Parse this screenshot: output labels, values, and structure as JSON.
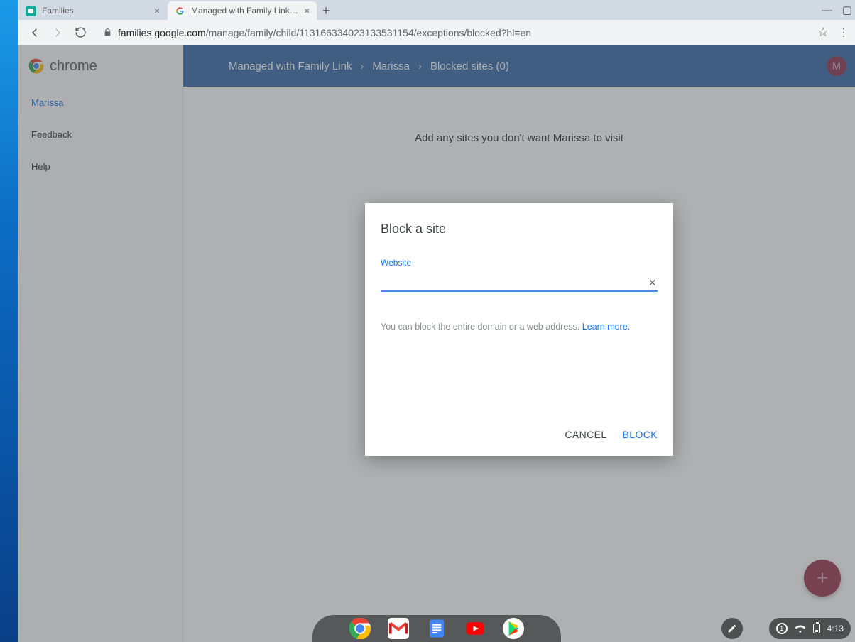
{
  "tabs": [
    {
      "title": "Families"
    },
    {
      "title": "Managed with Family Link > Exc…"
    }
  ],
  "window_controls": {
    "minimize": "—",
    "maximize": "▢"
  },
  "url": {
    "host": "families.google.com",
    "path": "/manage/family/child/113166334023133531154/exceptions/blocked?hl=en"
  },
  "sidebar": {
    "logo": "chrome",
    "items": [
      {
        "label": "Marissa"
      },
      {
        "label": "Feedback"
      },
      {
        "label": "Help"
      }
    ]
  },
  "breadcrumbs": [
    "Managed with Family Link",
    "Marissa",
    "Blocked sites (0)"
  ],
  "avatar_initial": "M",
  "page_heading": "Add any sites you don't want Marissa to visit",
  "modal": {
    "title": "Block a site",
    "field_label": "Website",
    "hint_text": "You can block the entire domain or a web address. ",
    "learn_more": "Learn more.",
    "cancel": "CANCEL",
    "block": "BLOCK"
  },
  "shelf": {
    "notifications": "1",
    "time": "4:13"
  }
}
